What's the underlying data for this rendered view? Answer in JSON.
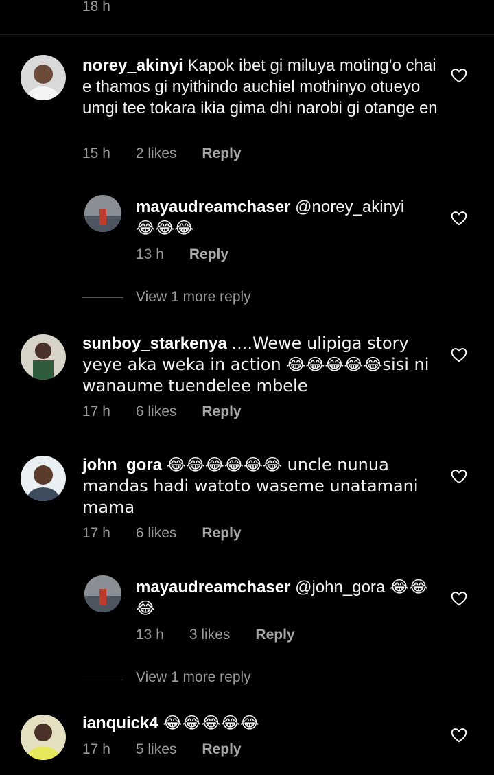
{
  "top": {
    "time": "18 h"
  },
  "comments": [
    {
      "username": "norey_akinyi",
      "text": "Kapok ibet gi miluya moting'o chai e thamos gi nyithindo auchiel mothinyo otueyo umgi tee tokara ikia gima dhi narobi gi otange en",
      "time": "15 h",
      "likes": "2 likes",
      "reply": "Reply"
    },
    {
      "username": "mayaudreamchaser",
      "mention": "@norey_akinyi",
      "text": "😂😂😂",
      "time": "13 h",
      "reply": "Reply",
      "view_more": "View 1 more reply"
    },
    {
      "username": "sunboy_starkenya",
      "text": "....Wewe ulipiga story yeye aka weka in action 😂😂😂😂😂sisi ni wanaume tuendelee mbele",
      "time": "17 h",
      "likes": "6 likes",
      "reply": "Reply"
    },
    {
      "username": "john_gora",
      "text": "😂😂😂😂😂😂 uncle nunua mandas hadi watoto waseme unatamani mama",
      "time": "17 h",
      "likes": "6 likes",
      "reply": "Reply"
    },
    {
      "username": "mayaudreamchaser",
      "mention": "@john_gora",
      "text": "😂😂😂",
      "time": "13 h",
      "likes": "3 likes",
      "reply": "Reply",
      "view_more": "View 1 more reply"
    },
    {
      "username": "ianquick4",
      "text": "😂😂😂😂😂",
      "time": "17 h",
      "likes": "5 likes",
      "reply": "Reply"
    }
  ],
  "icons": {
    "like": "heart-outline-icon"
  },
  "colors": {
    "background": "#000000",
    "meta_text": "#9a9a9a"
  }
}
